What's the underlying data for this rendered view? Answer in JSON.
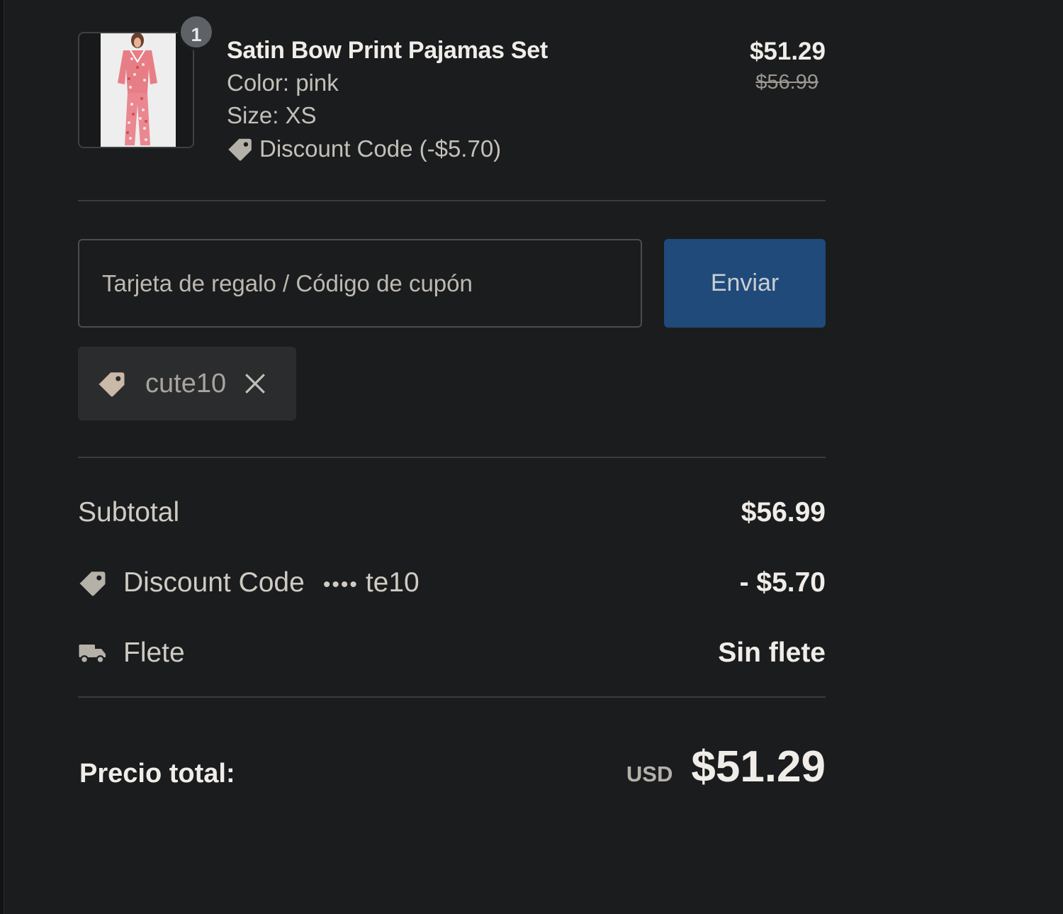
{
  "cart_item": {
    "quantity": "1",
    "name": "Satin Bow Print Pajamas Set",
    "color": "Color: pink",
    "size": "Size: XS",
    "discount": "Discount Code (-$5.70)",
    "price": "$51.29",
    "original_price": "$56.99",
    "image_icon": "pajamas-product-photo"
  },
  "coupon": {
    "placeholder": "Tarjeta de regalo / Código de cupón",
    "submit_label": "Enviar",
    "applied_code": "cute10"
  },
  "totals": {
    "subtotal_label": "Subtotal",
    "subtotal_value": "$56.99",
    "discount_label": "Discount Code",
    "discount_masked_dots": "••••",
    "discount_masked_suffix": "te10",
    "discount_value": "- $5.70",
    "shipping_label": "Flete",
    "shipping_value": "Sin flete"
  },
  "grand_total": {
    "label": "Precio total:",
    "currency": "USD",
    "amount": "$51.29"
  },
  "colors": {
    "background": "#1a1c1e",
    "button": "#1f4a7a",
    "divider": "#3a3c3e"
  }
}
